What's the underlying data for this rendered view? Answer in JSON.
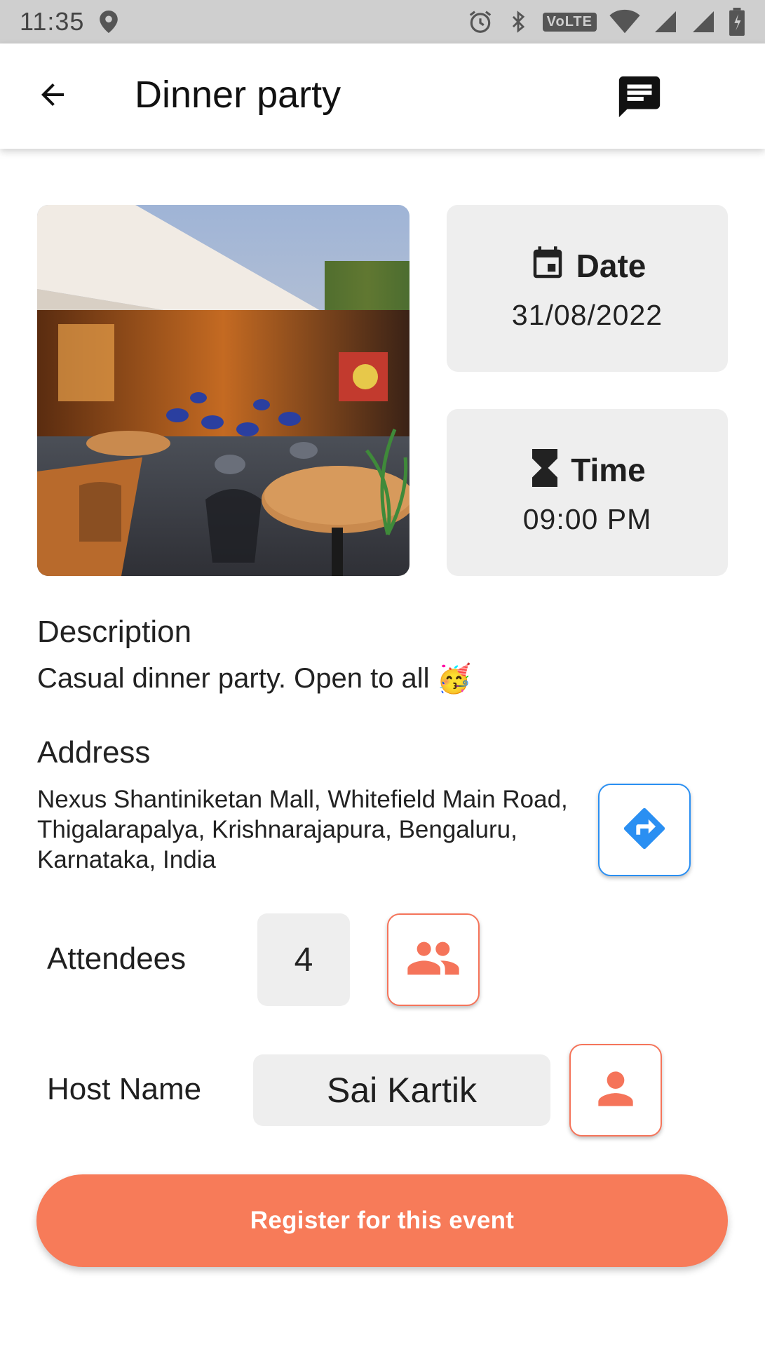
{
  "status_bar": {
    "time": "11:35",
    "network_label": "VoLTE"
  },
  "app_bar": {
    "title": "Dinner party",
    "back_icon": "arrow-back-icon",
    "chat_icon": "chat-icon"
  },
  "event": {
    "image_icon": "venue-photo",
    "date_label": "Date",
    "date_value": "31/08/2022",
    "time_label": "Time",
    "time_value": "09:00 PM",
    "description_heading": "Description",
    "description_text": "Casual dinner party. Open to all",
    "description_emoji": "🥳",
    "address_heading": "Address",
    "address_text": "Nexus Shantiniketan Mall, Whitefield Main Road, Thigalarapalya, Krishnarajapura, Bengaluru, Karnataka, India",
    "attendees_label": "Attendees",
    "attendees_count": "4",
    "host_label": "Host Name",
    "host_name": "Sai Kartik",
    "register_label": "Register for this event"
  },
  "colors": {
    "accent": "#f77b59",
    "directions": "#2a8ff2",
    "tile_bg": "#eeeeee"
  }
}
